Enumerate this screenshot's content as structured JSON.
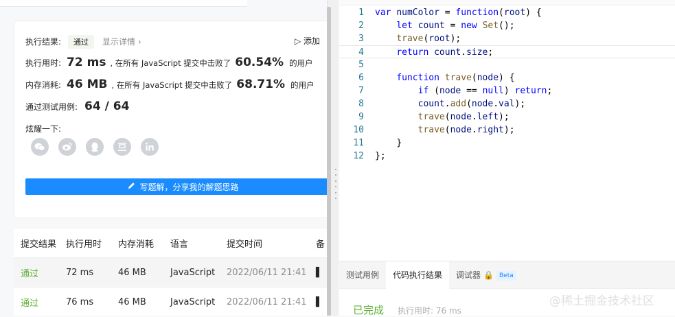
{
  "result": {
    "status_label": "执行结果:",
    "status_value": "通过",
    "detail_link": "显示详情 ›",
    "add_test": "▷ 添加",
    "runtime_label": "执行用时:",
    "runtime_value": "72 ms",
    "runtime_beat_prefix": ", 在所有 JavaScript 提交中击败了",
    "runtime_pct": "60.54%",
    "runtime_suffix": "的用户",
    "memory_label": "内存消耗:",
    "memory_value": "46 MB",
    "memory_beat_prefix": ", 在所有 JavaScript 提交中击败了",
    "memory_pct": "68.71%",
    "memory_suffix": "的用户",
    "cases_label": "通过测试用例:",
    "cases_value": "64 / 64",
    "share_label": "炫耀一下:",
    "share_icons": [
      "wechat-icon",
      "weibo-icon",
      "qq-icon",
      "douban-icon",
      "linkedin-icon"
    ],
    "write_button": "写题解，分享我的解题思路"
  },
  "submissions": {
    "headers": [
      "提交结果",
      "执行用时",
      "内存消耗",
      "语言",
      "提交时间",
      "备"
    ],
    "rows": [
      [
        "通过",
        "72 ms",
        "46 MB",
        "JavaScript",
        "2022/06/11 21:41",
        ""
      ],
      [
        "通过",
        "76 ms",
        "46 MB",
        "JavaScript",
        "2022/06/11 21:41",
        ""
      ]
    ]
  },
  "editor": {
    "active_line": 4,
    "lines": [
      {
        "n": "1",
        "text": "var numColor = function(root) {"
      },
      {
        "n": "2",
        "text": "    let count = new Set();"
      },
      {
        "n": "3",
        "text": "    trave(root);"
      },
      {
        "n": "4",
        "text": "    return count.size;"
      },
      {
        "n": "5",
        "text": ""
      },
      {
        "n": "6",
        "text": "    function trave(node) {"
      },
      {
        "n": "7",
        "text": "        if (node == null) return;"
      },
      {
        "n": "8",
        "text": "        count.add(node.val);"
      },
      {
        "n": "9",
        "text": "        trave(node.left);"
      },
      {
        "n": "10",
        "text": "        trave(node.right);"
      },
      {
        "n": "11",
        "text": "    }"
      },
      {
        "n": "12",
        "text": "};"
      }
    ]
  },
  "console": {
    "tabs": [
      "测试用例",
      "代码执行结果",
      "调试器"
    ],
    "active_tab": 1,
    "beta": "Beta",
    "done": "已完成",
    "runtime": "执行用时: 76 ms"
  },
  "watermark": "@稀土掘金技术社区",
  "colors": {
    "accent": "#1a8cff",
    "pass": "#5fb035",
    "keyword": "#0000ff",
    "function": "#795e26",
    "line_number": "#237893"
  }
}
